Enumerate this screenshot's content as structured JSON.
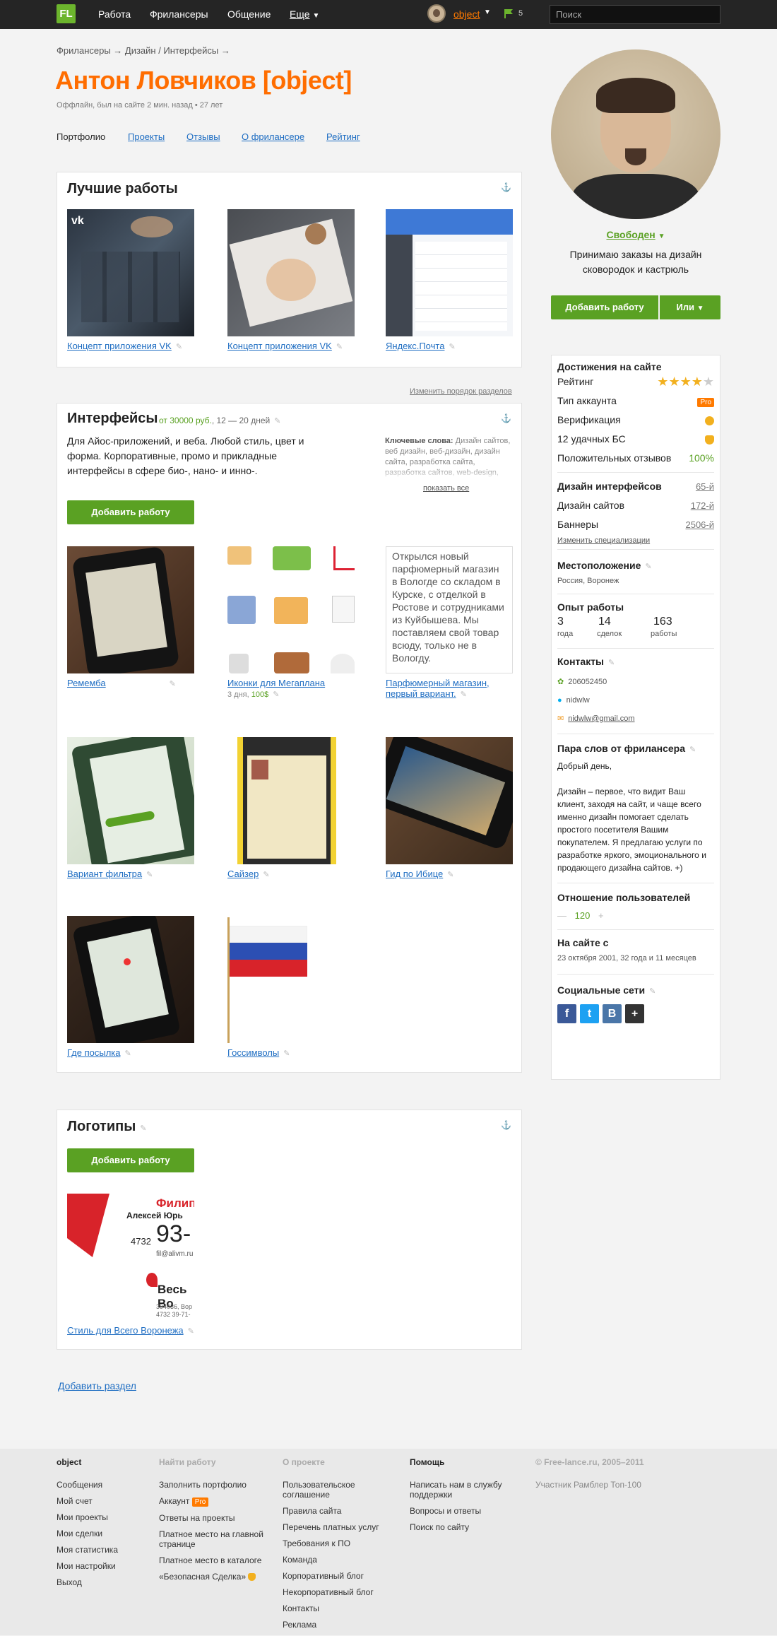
{
  "topbar": {
    "logo": "FL",
    "nav": [
      "Работа",
      "Фрилансеры",
      "Общение",
      "Еще"
    ],
    "user": "object",
    "count": "5",
    "search_placeholder": "Поиск"
  },
  "profile": {
    "breadcrumb": "Фрилансеры → Дизайн / Интерфейсы →",
    "name": "Антон Ловчиков [object]",
    "status": "Оффлайн, был на сайте 2 мин. назад • 27 лет",
    "tabs": [
      "Портфолио",
      "Проекты",
      "Отзывы",
      "О фрилансере",
      "Рейтинг"
    ]
  },
  "best": {
    "title": "Лучшие работы",
    "works": [
      {
        "title": "Концепт приложения VK"
      },
      {
        "title": "Концепт приложения VK"
      },
      {
        "title": "Яндекс.Почта"
      }
    ]
  },
  "reorder_link": "Изменить порядок разделов",
  "interfaces": {
    "title": "Интерфейсы",
    "price": "от 30000 руб.",
    "duration": ", 12 — 20 дней",
    "desc": "Для Айос-приложений, и веба. Любой стиль, цвет и форма. Корпоративные, промо и прикладные интерфейсы в сфере био-, нано- и инно-.",
    "keywords_label": "Ключевые слова:",
    "keywords": "Дизайн сайтов, веб дизайн, веб-дизайн, дизайн сайта, разработка сайта, разработка сайтов, web-design,",
    "show_all": "показать все",
    "add_button": "Добавить работу",
    "works": [
      {
        "title": "Ремемба"
      },
      {
        "title": "Иконки для Мегаплана",
        "meta": "3 дня, ",
        "price": "100$"
      },
      {
        "title": "Парфюмерный магазин, первый вариант."
      },
      {
        "title": "Вариант фильтра"
      },
      {
        "title": "Сайзер"
      },
      {
        "title": "Гид по Ибице"
      },
      {
        "title": "Где посылка"
      },
      {
        "title": "Госсимволы"
      }
    ],
    "text_card": "Открылся новый парфюмерный магазин в Вологде со складом в Курске, с отделкой в Ростове и сотрудниками из Куйбышева. Мы поставляем свой товар всюду, только не в Вологду."
  },
  "logos": {
    "title": "Логотипы",
    "add_button": "Добавить работу",
    "works": [
      {
        "title": "Стиль для Всего Воронежа"
      }
    ],
    "card": {
      "line1": "Филипп",
      "line2": "Алексей Юрь",
      "code": "4732",
      "number": "93-",
      "email": "fil@alivm.ru",
      "brand": "Весь Во",
      "addr1": "394036, Вор",
      "addr2": "4732 39-71-"
    }
  },
  "add_section": "Добавить раздел",
  "sidebar": {
    "availability": "Свободен",
    "tagline": "Принимаю заказы на дизайн сковородок и кастрюль",
    "add_button": "Добавить работу",
    "or_button": "Или",
    "achievements_title": "Достижения на сайте",
    "rating_label": "Рейтинг",
    "rating_stars": 4,
    "rating_max": 5,
    "account_label": "Тип аккаунта",
    "account_value": "Pro",
    "verification_label": "Верификация",
    "bs_label": "12 удачных БС",
    "positive_label": "Положительных отзывов",
    "positive_value": "100%",
    "specs": [
      {
        "label": "Дизайн интерфейсов",
        "value": "65-й"
      },
      {
        "label": "Дизайн сайтов",
        "value": "172-й"
      },
      {
        "label": "Баннеры",
        "value": "2506-й"
      }
    ],
    "change_specs": "Изменить специализации",
    "location_title": "Местоположение",
    "location": "Россия, Воронеж",
    "experience_title": "Опыт работы",
    "experience": [
      {
        "value": "3",
        "label": "года"
      },
      {
        "value": "14",
        "label": "сделок"
      },
      {
        "value": "163",
        "label": "работы"
      }
    ],
    "contacts_title": "Контакты",
    "contacts": {
      "icq": "206052450",
      "skype": "nidwlw",
      "email": "nidwlw@gmail.com"
    },
    "words_title": "Пара слов от фрилансера",
    "words_greeting": "Добрый день,",
    "words_body": "Дизайн – первое, что видит Ваш клиент, заходя на сайт, и чаще всего именно дизайн помогает сделать простого посетителя Вашим покупателем. Я предлагаю услуги по разработке яркого, эмоционального и продающего дизайна сайтов. +)",
    "attitude_title": "Отношение пользователей",
    "attitude_minus": "—",
    "attitude_value": "120",
    "attitude_plus": "+",
    "since_title": "На сайте с",
    "since": "23 октября 2001, 32 года и 11 месяцев",
    "social_title": "Социальные сети",
    "social": [
      "f",
      "t",
      "В",
      "+"
    ]
  },
  "footer": {
    "col1": {
      "title": "object",
      "items": [
        "Сообщения",
        "Мой счет",
        "Мои проекты",
        "Мои сделки",
        "Моя статистика",
        "Мои настройки",
        "Выход"
      ]
    },
    "col2": {
      "title": "Найти работу",
      "items": [
        "Заполнить портфолио",
        "Аккаунт",
        "Ответы на проекты",
        "Платное место на главной странице",
        "Платное место в каталоге",
        "«Безопасная Сделка»"
      ]
    },
    "col3": {
      "title": "О проекте",
      "items": [
        "Пользовательское соглашение",
        "Правила сайта",
        "Перечень платных услуг",
        "Требования к ПО",
        "Команда",
        "Корпоративный блог",
        "Некорпоративный блог",
        "Контакты",
        "Реклама"
      ]
    },
    "col4": {
      "title": "Помощь",
      "items": [
        "Написать нам в службу поддержки",
        "Вопросы и ответы",
        "Поиск по сайту"
      ]
    },
    "col5": {
      "copyright": "© Free-lance.ru, 2005–2011",
      "member": "Участник Рамблер Топ-100"
    }
  },
  "colors": {
    "accent": "#ff6d00",
    "green": "#5aa123",
    "link": "#1e6dc2"
  }
}
